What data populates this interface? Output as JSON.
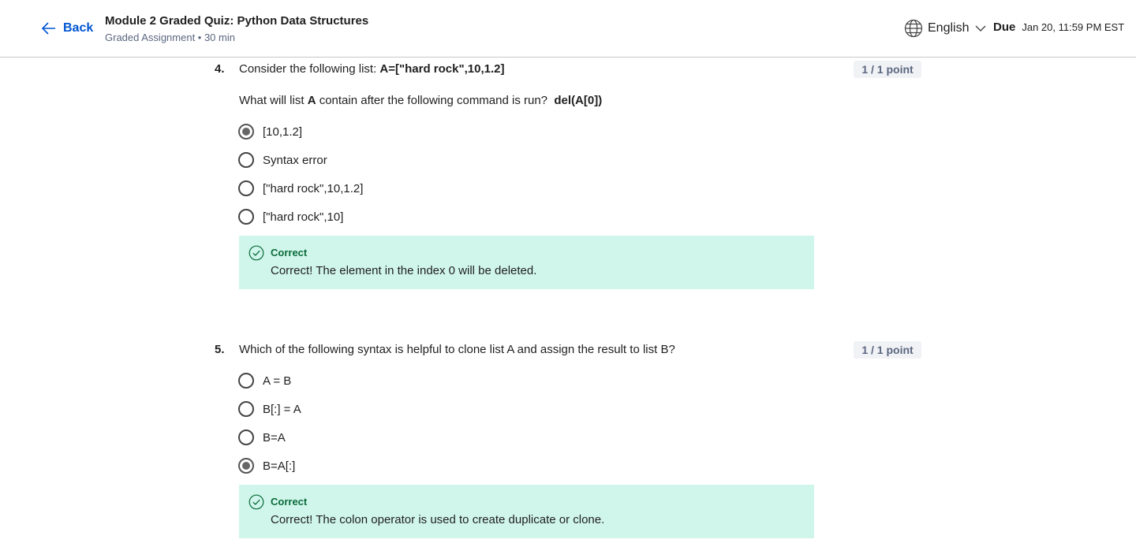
{
  "header": {
    "back_label": "Back",
    "title": "Module 2 Graded Quiz: Python Data Structures",
    "subtitle": "Graded Assignment • 30 min",
    "language": "English",
    "due_label": "Due",
    "due_value": "Jan 20, 11:59 PM EST"
  },
  "questions": [
    {
      "number": "4.",
      "text_prefix": "Consider the following list: ",
      "text_code": "A=[\"hard rock\",10,1.2]",
      "points": "1 / 1 point",
      "sub_prefix": "What will list ",
      "sub_bold": "A",
      "sub_mid": " contain after the following command is run?  ",
      "sub_code": "del(A[0])",
      "options": [
        "[10,1.2]",
        "Syntax error",
        "[\"hard rock\",10,1.2]",
        "[\"hard rock\",10]"
      ],
      "selected_index": 0,
      "feedback_title": "Correct",
      "feedback_text": "Correct! The element in the index 0 will be deleted."
    },
    {
      "number": "5.",
      "text": "Which of the following syntax is helpful to clone list A and assign the result to list B?",
      "points": "1 / 1 point",
      "options": [
        "A = B",
        "B[:] = A",
        "B=A",
        "B=A[:]"
      ],
      "selected_index": 3,
      "feedback_title": "Correct",
      "feedback_text": "Correct! The colon operator is used to create duplicate or clone."
    }
  ],
  "colors": {
    "accent": "#0056d2",
    "feedback_bg": "#d0f6ec",
    "feedback_title": "#0b6b3a",
    "points_bg": "#f0f2f5"
  },
  "icons": {
    "back": "arrow-left-icon",
    "language": "globe-icon",
    "dropdown": "chevron-down-icon",
    "feedback": "check-circle-icon"
  }
}
